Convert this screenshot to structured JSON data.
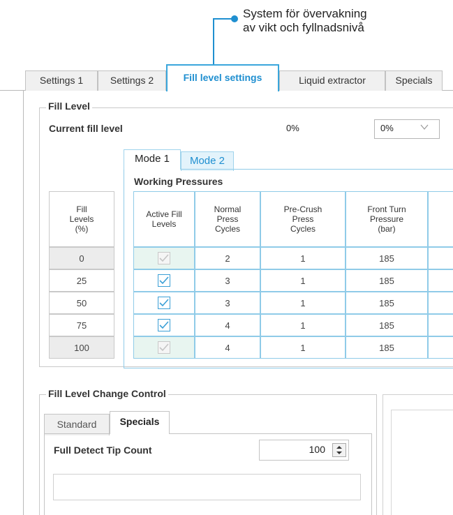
{
  "callout": {
    "line1": "System för övervakning",
    "line2": "av vikt och fyllnadsnivå"
  },
  "tabs": [
    {
      "label": "Settings 1"
    },
    {
      "label": "Settings 2"
    },
    {
      "label": "Fill level settings",
      "active": true
    },
    {
      "label": "Liquid extractor"
    },
    {
      "label": "Specials"
    }
  ],
  "fill_level": {
    "group_title": "Fill Level",
    "current_label": "Current fill level",
    "current_value": "0%",
    "combo_value": "0%"
  },
  "mode_tabs": [
    {
      "label": "Mode 1"
    },
    {
      "label": "Mode 2"
    }
  ],
  "working_pressures": {
    "title": "Working Pressures",
    "level_header": "Fill Levels (%)",
    "columns": [
      "Active Fill Levels",
      "Normal Press Cycles",
      "Pre-Crush Press Cycles",
      "Front Turn Pressure (bar)"
    ],
    "rows": [
      {
        "level": "0",
        "active": true,
        "enabled": false,
        "normal": "2",
        "precrush": "1",
        "pressure": "185"
      },
      {
        "level": "25",
        "active": true,
        "enabled": true,
        "normal": "3",
        "precrush": "1",
        "pressure": "185"
      },
      {
        "level": "50",
        "active": true,
        "enabled": true,
        "normal": "3",
        "precrush": "1",
        "pressure": "185"
      },
      {
        "level": "75",
        "active": true,
        "enabled": true,
        "normal": "4",
        "precrush": "1",
        "pressure": "185"
      },
      {
        "level": "100",
        "active": true,
        "enabled": false,
        "normal": "4",
        "precrush": "1",
        "pressure": "185"
      }
    ]
  },
  "change_control": {
    "group_title": "Fill Level Change Control",
    "tabs": [
      {
        "label": "Standard"
      },
      {
        "label": "Specials",
        "active": true
      }
    ],
    "tip_label": "Full Detect Tip Count",
    "tip_value": "100"
  },
  "colors": {
    "accent": "#1f8fd0",
    "tab_border": "#39a6dc",
    "check": "#3a9fd6"
  }
}
